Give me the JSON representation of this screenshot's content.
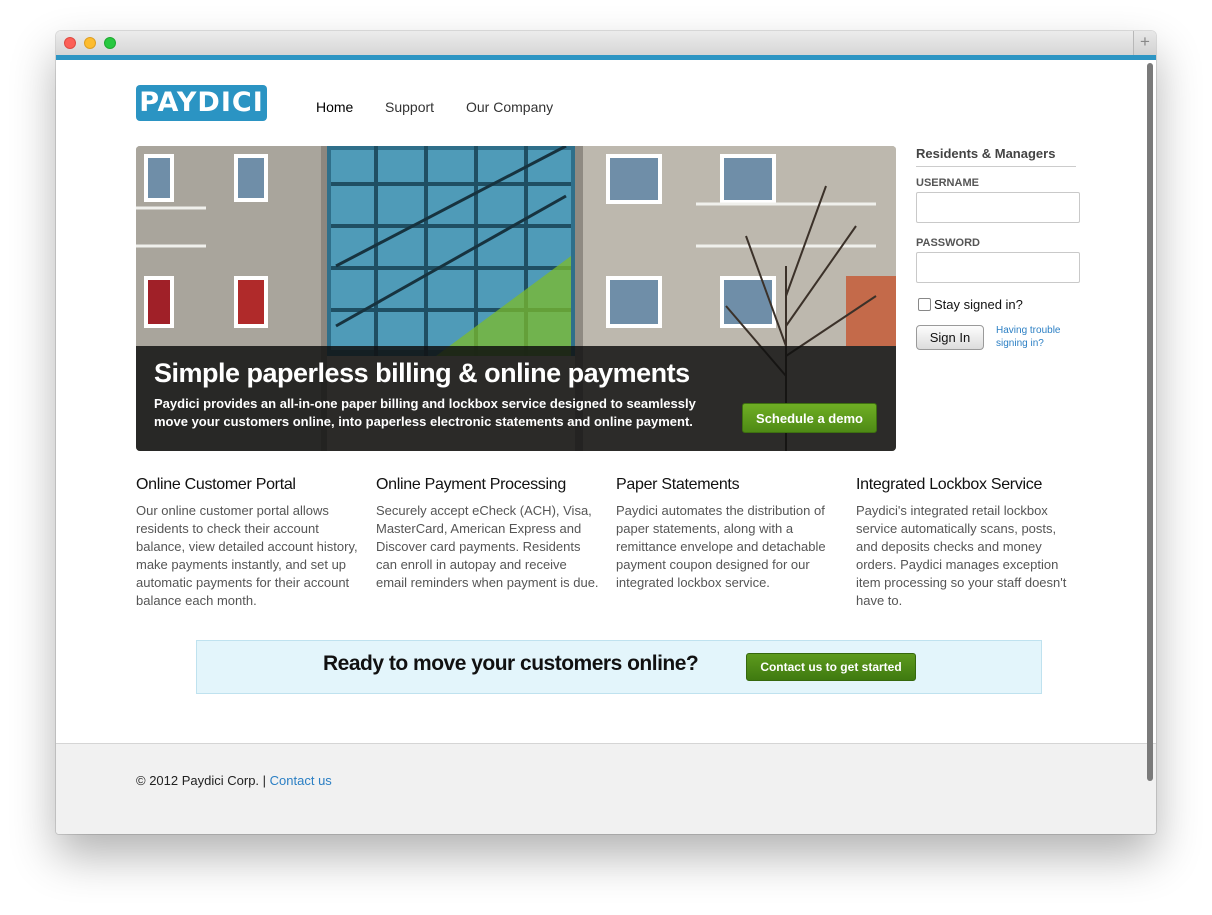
{
  "brand": {
    "logo_text": "PAYDICI",
    "accent": "#2d95c3",
    "button_green": "#5d9a1d"
  },
  "nav": [
    {
      "label": "Home"
    },
    {
      "label": "Support"
    },
    {
      "label": "Our Company"
    }
  ],
  "hero": {
    "title": "Simple paperless billing & online payments",
    "description": "Paydici provides an all-in-one paper billing and lockbox service designed to seamlessly move your customers online, into paperless electronic statements and online payment.",
    "demo_button": "Schedule a demo"
  },
  "login": {
    "title": "Residents & Managers",
    "username_label": "USERNAME",
    "username_value": "",
    "password_label": "PASSWORD",
    "password_value": "",
    "stay_signed_in": "Stay signed in?",
    "signin_button": "Sign In",
    "trouble_link": "Having trouble signing in?"
  },
  "features": [
    {
      "title": "Online Customer Portal",
      "text": "Our online customer portal allows residents to check their account balance, view detailed account history, make payments instantly, and set up automatic payments for their account balance each month."
    },
    {
      "title": "Online Payment Processing",
      "text": "Securely accept eCheck (ACH), Visa, MasterCard, American Express and Discover card payments. Residents can enroll in autopay and receive email reminders when payment is due."
    },
    {
      "title": "Paper Statements",
      "text": "Paydici automates the distribution of paper statements, along with a remittance envelope and detachable payment coupon designed for our integrated lockbox service."
    },
    {
      "title": "Integrated Lockbox Service",
      "text": "Paydici's integrated retail lockbox service automatically scans, posts, and deposits checks and money orders. Paydici manages exception item processing so your staff doesn't have to."
    }
  ],
  "cta": {
    "text": "Ready to move your customers online?",
    "button": "Contact us to get started"
  },
  "footer": {
    "copyright": "© 2012 Paydici Corp. |",
    "contact_link": "Contact us"
  }
}
